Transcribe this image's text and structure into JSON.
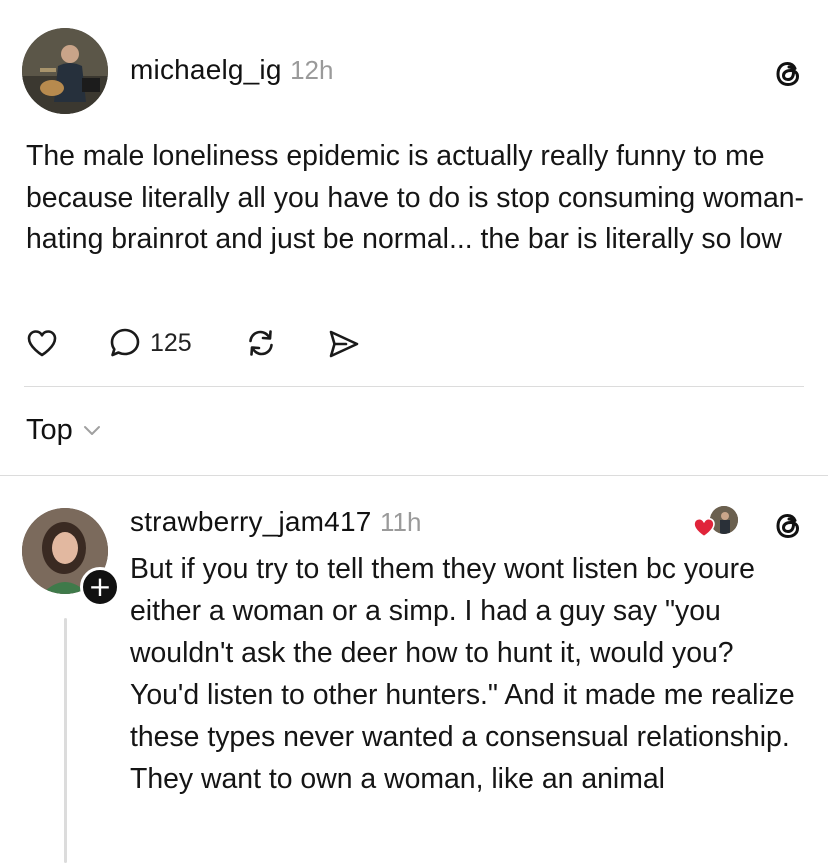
{
  "post": {
    "username": "michaelg_ig",
    "time": "12h",
    "text": "The male loneliness epidemic is actually really funny to me because literally all you have to do is stop consuming woman-hating brainrot and just be normal... the bar is literally so low",
    "reply_count": "125",
    "icons": [
      "threads-logo-icon",
      "heart-icon",
      "comment-icon",
      "repost-icon",
      "share-icon"
    ]
  },
  "sort": {
    "label": "Top",
    "icon": "chevron-down-icon"
  },
  "reply": {
    "username": "strawberry_jam417",
    "time": "11h",
    "text": "But if you try to tell them they wont listen bc youre either a woman or a simp. I had a guy say \"you wouldn't ask the deer how to hunt it, would you? You'd listen to other hunters.\" And it made me realize these types never wanted a consensual relationship. They want to own a woman, like an animal",
    "follow_badge": "+",
    "icons": [
      "threads-logo-icon",
      "liked-by-author-heart-icon",
      "follow-plus-icon"
    ]
  },
  "colors": {
    "text": "#151515",
    "muted": "#9a9a9a",
    "divider": "#dcdcdc",
    "heart_red": "#e0243a"
  }
}
